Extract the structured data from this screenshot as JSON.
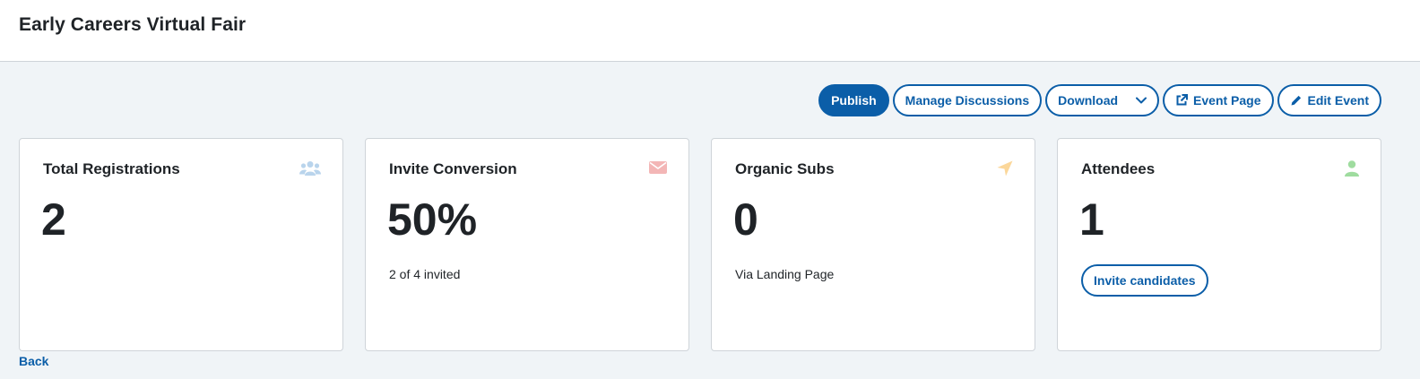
{
  "header": {
    "title": "Early Careers Virtual Fair"
  },
  "toolbar": {
    "publish_label": "Publish",
    "manage_discussions_label": "Manage Discussions",
    "download_label": "Download",
    "event_page_label": "Event Page",
    "edit_event_label": "Edit Event"
  },
  "cards": [
    {
      "title": "Total Registrations",
      "value": "2",
      "subtitle": "",
      "icon": "users-icon",
      "icon_color": "#b9d4ec"
    },
    {
      "title": "Invite Conversion",
      "value": "50%",
      "subtitle": "2 of 4 invited",
      "icon": "envelope-icon",
      "icon_color": "#f3b6b6"
    },
    {
      "title": "Organic Subs",
      "value": "0",
      "subtitle": "Via Landing Page",
      "icon": "paper-plane-icon",
      "icon_color": "#fbd79a"
    },
    {
      "title": "Attendees",
      "value": "1",
      "button_label": "Invite candidates",
      "icon": "user-icon",
      "icon_color": "#9fdc9f"
    }
  ],
  "footer": {
    "back_label": "Back"
  },
  "colors": {
    "accent": "#0b5ea8",
    "background": "#f0f4f7"
  }
}
